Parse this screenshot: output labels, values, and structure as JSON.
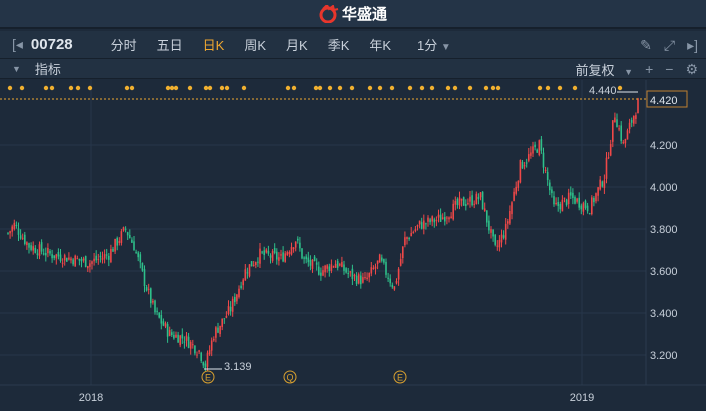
{
  "app": {
    "title": "华盛通"
  },
  "toolbar": {
    "code": "00728",
    "tabs": [
      "分时",
      "五日",
      "日K",
      "周K",
      "月K",
      "季K",
      "年K"
    ],
    "active": "日K",
    "interval": "1分"
  },
  "indicator": {
    "label": "指标",
    "adjust": "前复权"
  },
  "price_axis": {
    "ticks": [
      "4.420",
      "4.200",
      "4.000",
      "3.800",
      "3.600",
      "3.400",
      "3.200"
    ],
    "current": "4.420"
  },
  "annotations": {
    "high": "4.440",
    "low": "3.139"
  },
  "date_axis": {
    "labels": [
      "2018",
      "2019"
    ]
  },
  "events": [
    "E",
    "Q",
    "E"
  ],
  "colors": {
    "up": "#f04848",
    "down": "#2ec08a",
    "accent": "#f0a830"
  },
  "chart_data": {
    "type": "candlestick",
    "anchors": [
      [
        0,
        3.78
      ],
      [
        3,
        3.82
      ],
      [
        10,
        3.72
      ],
      [
        20,
        3.68
      ],
      [
        30,
        3.66
      ],
      [
        39,
        3.64
      ],
      [
        48,
        3.68
      ],
      [
        56,
        3.8
      ],
      [
        60,
        3.72
      ],
      [
        65,
        3.55
      ],
      [
        70,
        3.4
      ],
      [
        77,
        3.3
      ],
      [
        84,
        3.28
      ],
      [
        91,
        3.22
      ],
      [
        94,
        3.15
      ],
      [
        98,
        3.3
      ],
      [
        106,
        3.42
      ],
      [
        113,
        3.6
      ],
      [
        120,
        3.68
      ],
      [
        130,
        3.66
      ],
      [
        137,
        3.75
      ],
      [
        141,
        3.65
      ],
      [
        149,
        3.6
      ],
      [
        156,
        3.64
      ],
      [
        163,
        3.58
      ],
      [
        170,
        3.55
      ],
      [
        177,
        3.65
      ],
      [
        184,
        3.52
      ],
      [
        189,
        3.75
      ],
      [
        196,
        3.82
      ],
      [
        206,
        3.85
      ],
      [
        215,
        3.92
      ],
      [
        225,
        3.95
      ],
      [
        232,
        3.7
      ],
      [
        237,
        3.8
      ],
      [
        244,
        4.1
      ],
      [
        253,
        4.2
      ],
      [
        260,
        3.9
      ],
      [
        268,
        3.95
      ],
      [
        277,
        3.9
      ],
      [
        284,
        4.05
      ],
      [
        289,
        4.35
      ],
      [
        293,
        4.2
      ],
      [
        300,
        4.4
      ]
    ],
    "ylim": [
      3.1,
      4.48
    ]
  }
}
